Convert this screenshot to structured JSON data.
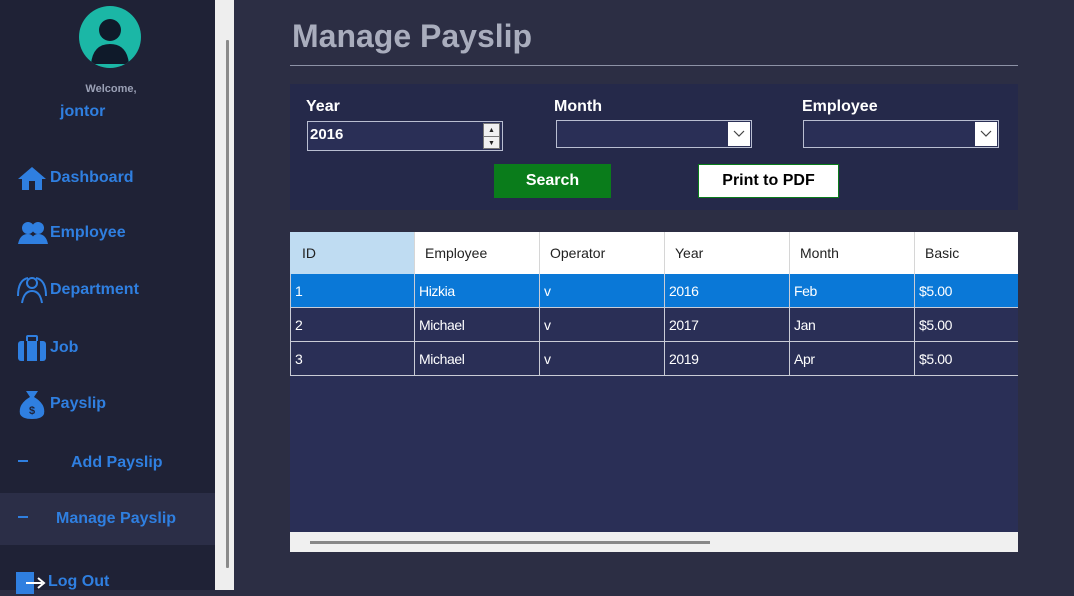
{
  "sidebar": {
    "welcome": "Welcome,",
    "username": "jontor",
    "items": [
      {
        "label": "Dashboard",
        "icon": "home-icon"
      },
      {
        "label": "Employee",
        "icon": "users-icon"
      },
      {
        "label": "Department",
        "icon": "department-icon"
      },
      {
        "label": "Job",
        "icon": "briefcase-icon"
      },
      {
        "label": "Payslip",
        "icon": "money-bag-icon"
      }
    ],
    "subitems": [
      {
        "label": "Add Payslip"
      },
      {
        "label": "Manage Payslip"
      }
    ],
    "logout": "Log Out"
  },
  "page": {
    "title": "Manage Payslip"
  },
  "filters": {
    "year_label": "Year",
    "year_value": "2016",
    "month_label": "Month",
    "employee_label": "Employee",
    "search_label": "Search",
    "pdf_label": "Print to PDF"
  },
  "table": {
    "columns": [
      "ID",
      "Employee",
      "Operator",
      "Year",
      "Month",
      "Basic"
    ],
    "rows": [
      [
        "1",
        "Hizkia",
        "v",
        "2016",
        "Feb",
        "$5.00"
      ],
      [
        "2",
        "Michael",
        "v",
        "2017",
        "Jan",
        "$5.00"
      ],
      [
        "3",
        "Michael",
        "v",
        "2019",
        "Apr",
        "$5.00"
      ]
    ]
  },
  "colors": {
    "accent": "#2f7fe0",
    "search_button": "#0a7c1b",
    "selected_row": "#0a78d7"
  }
}
